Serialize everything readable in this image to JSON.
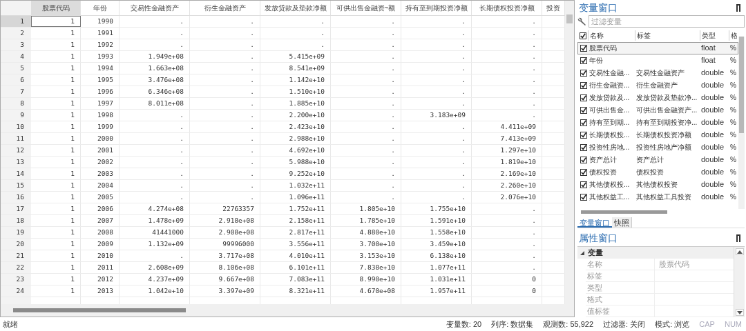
{
  "grid": {
    "columns": [
      "股票代码",
      "年份",
      "交易性金融资产",
      "衍生金融资产",
      "发放贷款及垫款净额",
      "可供出售金融资~额",
      "持有至到期投资净额",
      "长期债权投资净额",
      "投资"
    ],
    "rows": [
      {
        "number": "1",
        "selected": true,
        "cells": [
          "1",
          "1990",
          ".",
          ".",
          ".",
          ".",
          ".",
          "."
        ]
      },
      {
        "number": "2",
        "selected": false,
        "cells": [
          "1",
          "1991",
          ".",
          ".",
          ".",
          ".",
          ".",
          "."
        ]
      },
      {
        "number": "3",
        "selected": false,
        "cells": [
          "1",
          "1992",
          ".",
          ".",
          ".",
          ".",
          ".",
          "."
        ]
      },
      {
        "number": "4",
        "selected": false,
        "cells": [
          "1",
          "1993",
          "1.949e+08",
          ".",
          "5.415e+09",
          ".",
          ".",
          "."
        ]
      },
      {
        "number": "5",
        "selected": false,
        "cells": [
          "1",
          "1994",
          "1.663e+08",
          ".",
          "8.541e+09",
          ".",
          ".",
          "."
        ]
      },
      {
        "number": "6",
        "selected": false,
        "cells": [
          "1",
          "1995",
          "3.476e+08",
          ".",
          "1.142e+10",
          ".",
          ".",
          "."
        ]
      },
      {
        "number": "7",
        "selected": false,
        "cells": [
          "1",
          "1996",
          "6.346e+08",
          ".",
          "1.510e+10",
          ".",
          ".",
          "."
        ]
      },
      {
        "number": "8",
        "selected": false,
        "cells": [
          "1",
          "1997",
          "8.011e+08",
          ".",
          "1.885e+10",
          ".",
          ".",
          "."
        ]
      },
      {
        "number": "9",
        "selected": false,
        "cells": [
          "1",
          "1998",
          ".",
          ".",
          "2.200e+10",
          ".",
          "3.183e+09",
          "."
        ]
      },
      {
        "number": "10",
        "selected": false,
        "cells": [
          "1",
          "1999",
          ".",
          ".",
          "2.423e+10",
          ".",
          ".",
          "4.411e+09"
        ]
      },
      {
        "number": "11",
        "selected": false,
        "cells": [
          "1",
          "2000",
          ".",
          ".",
          "2.988e+10",
          ".",
          ".",
          "7.413e+09"
        ]
      },
      {
        "number": "12",
        "selected": false,
        "cells": [
          "1",
          "2001",
          ".",
          ".",
          "4.692e+10",
          ".",
          ".",
          "1.297e+10"
        ]
      },
      {
        "number": "13",
        "selected": false,
        "cells": [
          "1",
          "2002",
          ".",
          ".",
          "5.988e+10",
          ".",
          ".",
          "1.819e+10"
        ]
      },
      {
        "number": "14",
        "selected": false,
        "cells": [
          "1",
          "2003",
          ".",
          ".",
          "9.252e+10",
          ".",
          ".",
          "2.169e+10"
        ]
      },
      {
        "number": "15",
        "selected": false,
        "cells": [
          "1",
          "2004",
          ".",
          ".",
          "1.032e+11",
          ".",
          ".",
          "2.260e+10"
        ]
      },
      {
        "number": "16",
        "selected": false,
        "cells": [
          "1",
          "2005",
          ".",
          ".",
          "1.096e+11",
          ".",
          ".",
          "2.076e+10"
        ]
      },
      {
        "number": "17",
        "selected": false,
        "cells": [
          "1",
          "2006",
          "4.274e+08",
          "22763357",
          "1.752e+11",
          "1.805e+10",
          "1.755e+10",
          "."
        ]
      },
      {
        "number": "18",
        "selected": false,
        "cells": [
          "1",
          "2007",
          "1.478e+09",
          "2.918e+08",
          "2.158e+11",
          "1.785e+10",
          "1.591e+10",
          "."
        ]
      },
      {
        "number": "19",
        "selected": false,
        "cells": [
          "1",
          "2008",
          "41441000",
          "2.908e+08",
          "2.817e+11",
          "4.880e+10",
          "1.558e+10",
          "."
        ]
      },
      {
        "number": "20",
        "selected": false,
        "cells": [
          "1",
          "2009",
          "1.132e+09",
          "99996000",
          "3.556e+11",
          "3.700e+10",
          "3.459e+10",
          "."
        ]
      },
      {
        "number": "21",
        "selected": false,
        "cells": [
          "1",
          "2010",
          ".",
          "3.717e+08",
          "4.010e+11",
          "3.153e+10",
          "6.138e+10",
          "."
        ]
      },
      {
        "number": "22",
        "selected": false,
        "cells": [
          "1",
          "2011",
          "2.608e+09",
          "8.106e+08",
          "6.101e+11",
          "7.838e+10",
          "1.077e+11",
          "."
        ]
      },
      {
        "number": "23",
        "selected": false,
        "cells": [
          "1",
          "2012",
          "4.237e+09",
          "9.667e+08",
          "7.083e+11",
          "8.990e+10",
          "1.031e+11",
          "0"
        ]
      },
      {
        "number": "24",
        "selected": false,
        "cells": [
          "1",
          "2013",
          "1.042e+10",
          "3.397e+09",
          "8.321e+11",
          "4.670e+08",
          "1.957e+11",
          "0"
        ]
      }
    ]
  },
  "variables_window": {
    "title": "变量窗口",
    "filter": {
      "placeholder": "过滤变量"
    },
    "all_checked": true,
    "columns": [
      "名称",
      "标签",
      "类型",
      "格"
    ],
    "rows": [
      {
        "name": "股票代码",
        "label": "",
        "type": "float",
        "format": "%",
        "checked": true,
        "selected": true
      },
      {
        "name": "年份",
        "label": "",
        "type": "float",
        "format": "%",
        "checked": true,
        "selected": false
      },
      {
        "name": "交易性金融...",
        "label": "交易性金融资产",
        "type": "double",
        "format": "%",
        "checked": true,
        "selected": false
      },
      {
        "name": "衍生金融资...",
        "label": "衍生金融资产",
        "type": "double",
        "format": "%",
        "checked": true,
        "selected": false
      },
      {
        "name": "发放贷款及...",
        "label": "发放贷款及垫款净...",
        "type": "double",
        "format": "%",
        "checked": true,
        "selected": false
      },
      {
        "name": "可供出售金...",
        "label": "可供出售金融资产...",
        "type": "double",
        "format": "%",
        "checked": true,
        "selected": false
      },
      {
        "name": "持有至到期...",
        "label": "持有至到期投资净...",
        "type": "double",
        "format": "%",
        "checked": true,
        "selected": false
      },
      {
        "name": "长期债权投...",
        "label": "长期债权投资净额",
        "type": "double",
        "format": "%",
        "checked": true,
        "selected": false
      },
      {
        "name": "投资性房地...",
        "label": "投资性房地产净额",
        "type": "double",
        "format": "%",
        "checked": true,
        "selected": false
      },
      {
        "name": "资产总计",
        "label": "资产总计",
        "type": "double",
        "format": "%",
        "checked": true,
        "selected": false
      },
      {
        "name": "债权投资",
        "label": "债权投资",
        "type": "double",
        "format": "%",
        "checked": true,
        "selected": false
      },
      {
        "name": "其他债权投...",
        "label": "其他债权投资",
        "type": "double",
        "format": "%",
        "checked": true,
        "selected": false
      },
      {
        "name": "其他权益工...",
        "label": "其他权益工具投资",
        "type": "double",
        "format": "%",
        "checked": true,
        "selected": false
      }
    ]
  },
  "panel_tabs": [
    {
      "label": "变量窗口",
      "selected": true
    },
    {
      "label": "快照",
      "selected": false
    }
  ],
  "properties_window": {
    "title": "属性窗口",
    "section": {
      "label": "变量",
      "expanded": true
    },
    "rows": [
      {
        "key": "名称",
        "value": "股票代码"
      },
      {
        "key": "标签"
      },
      {
        "key": "类型"
      },
      {
        "key": "格式"
      },
      {
        "key": "值标签"
      }
    ]
  },
  "status_bar": {
    "message": "就绪",
    "items": [
      "变量数: 20",
      "列序: 数据集",
      "观测数: 55,922",
      "过滤器: 关闭",
      "模式: 浏览"
    ],
    "indicators": [
      {
        "label": "CAP",
        "on": false
      },
      {
        "label": "NUM",
        "on": false
      }
    ]
  }
}
